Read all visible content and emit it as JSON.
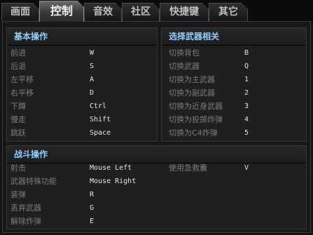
{
  "tabs": [
    {
      "label": "画面",
      "active": false
    },
    {
      "label": "控制",
      "active": true
    },
    {
      "label": "音效",
      "active": false
    },
    {
      "label": "社区",
      "active": false
    },
    {
      "label": "快捷键",
      "active": false
    },
    {
      "label": "其它",
      "active": false
    }
  ],
  "basic": {
    "title": "基本操作",
    "rows": [
      {
        "label": "前进",
        "key": "W"
      },
      {
        "label": "后退",
        "key": "S"
      },
      {
        "label": "左平移",
        "key": "A"
      },
      {
        "label": "右平移",
        "key": "D"
      },
      {
        "label": "下蹲",
        "key": "Ctrl"
      },
      {
        "label": "慢走",
        "key": "Shift"
      },
      {
        "label": "跳跃",
        "key": "Space"
      }
    ]
  },
  "weapon": {
    "title": "选择武器相关",
    "rows": [
      {
        "label": "切换背包",
        "key": "B"
      },
      {
        "label": "切换武器",
        "key": "Q"
      },
      {
        "label": "切换为主武器",
        "key": "1"
      },
      {
        "label": "切换为副武器",
        "key": "2"
      },
      {
        "label": "切换为近身武器",
        "key": "3"
      },
      {
        "label": "切换为投掷炸弹",
        "key": "4"
      },
      {
        "label": "切换为C4炸弹",
        "key": "5"
      }
    ]
  },
  "combat": {
    "title": "战斗操作",
    "rows": [
      {
        "label": "射击",
        "key": "Mouse Left"
      },
      {
        "label": "武器特殊功能",
        "key": "Mouse Right"
      },
      {
        "label": "装弹",
        "key": "R"
      },
      {
        "label": "丢弃武器",
        "key": "G"
      },
      {
        "label": "解除炸弹",
        "key": "E"
      }
    ],
    "extra": {
      "label": "使用急救囊",
      "key": "V"
    }
  },
  "colors": {
    "title_accent": "#8fd0ff",
    "label": "#7c7c7c",
    "value": "#e6e6e6"
  }
}
